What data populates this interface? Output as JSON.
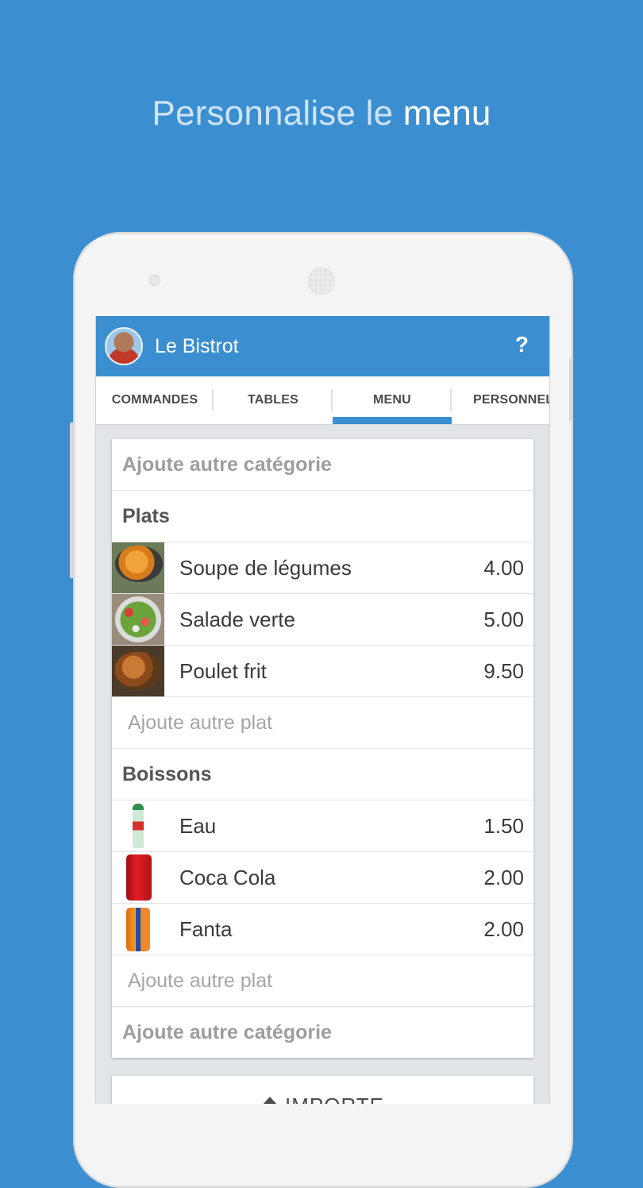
{
  "promo": {
    "headline_light": "Personnalise le",
    "headline_bold": "menu"
  },
  "appbar": {
    "title": "Le Bistrot",
    "help": "?"
  },
  "tabs": [
    {
      "label": "COMMANDES"
    },
    {
      "label": "TABLES"
    },
    {
      "label": "MENU",
      "active": true
    },
    {
      "label": "PERSONNEL"
    }
  ],
  "menu": {
    "add_category_top": "Ajoute autre catégorie",
    "categories": [
      {
        "name": "Plats",
        "items": [
          {
            "name": "Soupe de légumes",
            "price": "4.00",
            "icon": "soup-photo"
          },
          {
            "name": "Salade verte",
            "price": "5.00",
            "icon": "salad-photo"
          },
          {
            "name": "Poulet frit",
            "price": "9.50",
            "icon": "fried-chicken-photo"
          }
        ],
        "add_item": "Ajoute autre plat"
      },
      {
        "name": "Boissons",
        "items": [
          {
            "name": "Eau",
            "price": "1.50",
            "icon": "water-bottle-photo"
          },
          {
            "name": "Coca Cola",
            "price": "2.00",
            "icon": "coca-cola-can-photo"
          },
          {
            "name": "Fanta",
            "price": "2.00",
            "icon": "fanta-can-photo"
          }
        ],
        "add_item": "Ajoute autre plat"
      }
    ],
    "add_category_bottom": "Ajoute autre catégorie"
  },
  "import": {
    "label": "IMPORTE",
    "icon": "upload-icon"
  },
  "colors": {
    "primary": "#3b8fd1",
    "background": "#3b8fd1"
  }
}
